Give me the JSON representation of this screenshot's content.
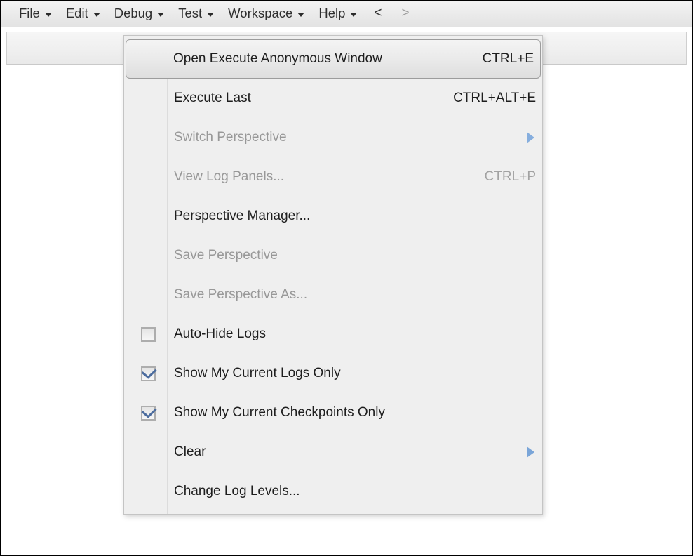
{
  "menu_bar": {
    "items": [
      {
        "label": "File",
        "has_caret": true
      },
      {
        "label": "Edit",
        "has_caret": true
      },
      {
        "label": "Debug",
        "has_caret": true
      },
      {
        "label": "Test",
        "has_caret": true
      },
      {
        "label": "Workspace",
        "has_caret": true
      },
      {
        "label": "Help",
        "has_caret": true
      }
    ],
    "nav_back": "<",
    "nav_forward": ">",
    "nav_back_enabled": true,
    "nav_forward_enabled": false
  },
  "debug_menu": {
    "open_from": "Debug",
    "items": [
      {
        "label": "Open Execute Anonymous Window",
        "shortcut": "CTRL+E",
        "state": "highlighted",
        "control": "none",
        "submenu": false
      },
      {
        "label": "Execute Last",
        "shortcut": "CTRL+ALT+E",
        "state": "enabled",
        "control": "none",
        "submenu": false
      },
      {
        "label": "Switch Perspective",
        "shortcut": "",
        "state": "disabled",
        "control": "none",
        "submenu": true
      },
      {
        "label": "View Log Panels...",
        "shortcut": "CTRL+P",
        "state": "disabled",
        "control": "none",
        "submenu": false
      },
      {
        "label": "Perspective Manager...",
        "shortcut": "",
        "state": "enabled",
        "control": "none",
        "submenu": false
      },
      {
        "label": "Save Perspective",
        "shortcut": "",
        "state": "disabled",
        "control": "none",
        "submenu": false
      },
      {
        "label": "Save Perspective As...",
        "shortcut": "",
        "state": "disabled",
        "control": "none",
        "submenu": false
      },
      {
        "label": "Auto-Hide Logs",
        "shortcut": "",
        "state": "enabled",
        "control": "checkbox",
        "checked": false,
        "submenu": false
      },
      {
        "label": "Show My Current Logs Only",
        "shortcut": "",
        "state": "enabled",
        "control": "checkbox",
        "checked": true,
        "submenu": false
      },
      {
        "label": "Show My Current Checkpoints Only",
        "shortcut": "",
        "state": "enabled",
        "control": "checkbox",
        "checked": true,
        "submenu": false
      },
      {
        "label": "Clear",
        "shortcut": "",
        "state": "enabled",
        "control": "none",
        "submenu": true
      },
      {
        "label": "Change Log Levels...",
        "shortcut": "",
        "state": "enabled",
        "control": "none",
        "submenu": false
      }
    ]
  },
  "colors": {
    "menu_bg": "#efefef",
    "menu_border": "#c4c4c4",
    "text": "#1e1e1e",
    "text_disabled": "#989898",
    "submenu_arrow": "#7aa5d8",
    "check_mark": "#4c6c9e",
    "menubar_bg": "#eaeaea",
    "canvas_bg": "#ffffff"
  }
}
